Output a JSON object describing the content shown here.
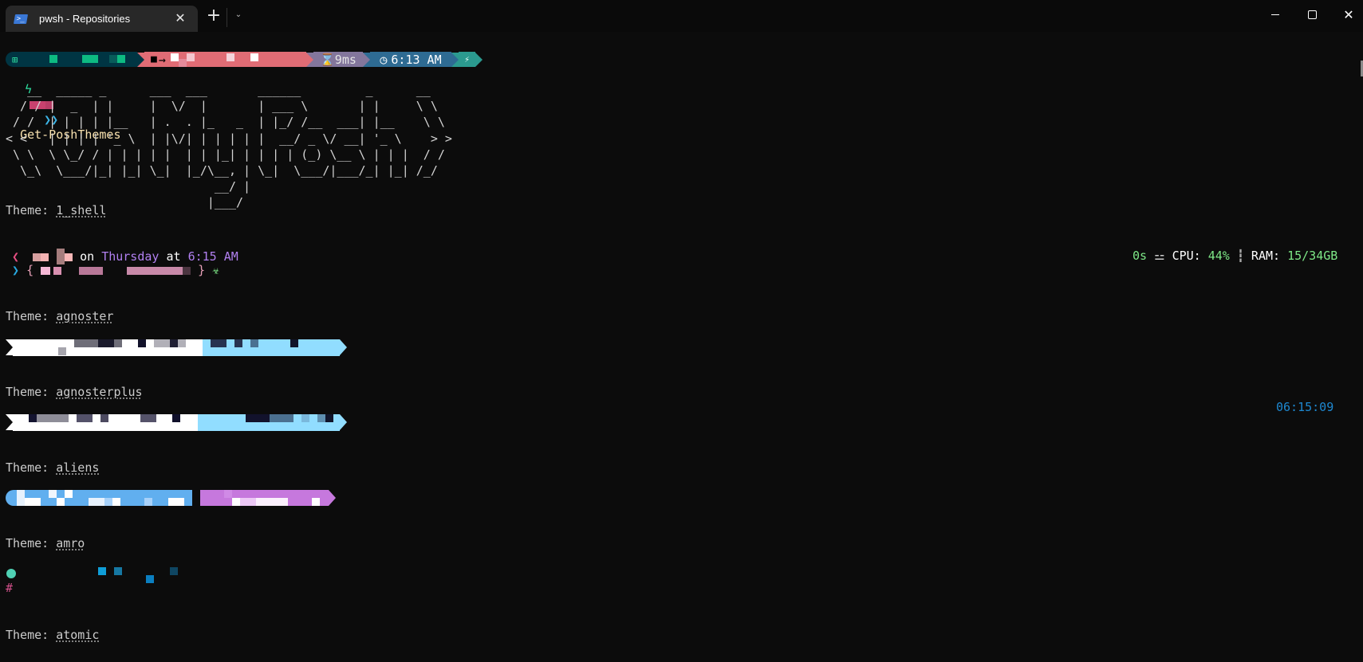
{
  "window": {
    "tab_title": "pwsh - Repositories",
    "tab_icon": "powershell-icon",
    "new_tab_label": "+",
    "dropdown_icon": "chevron-down-icon",
    "controls": [
      "minimize",
      "maximize",
      "close"
    ]
  },
  "prompt": {
    "segments": {
      "os_icon": "windows-icon",
      "path_icon": "folder-icon",
      "path_arrow": "→",
      "duration": "9ms",
      "duration_icon": "hourglass-icon",
      "time": "6:13 AM",
      "time_icon": "clock-icon",
      "status_icon": "lightning-icon"
    },
    "line2_icon": "lightning-icon",
    "chevron": "❯❯",
    "command": "Get-PoshThemes"
  },
  "banner": {
    "lines": [
      "   __  _____ _      ___  ___       ______         _      __   ",
      "  / / |  _  | |     |  \\/  |       | ___ \\       | |     \\ \\  ",
      " / /  | | | | |__   | .  . |_   _  | |_/ /__  ___| |__    \\ \\ ",
      "< <   | | | | '_ \\  | |\\/| | | | | |  __/ _ \\/ __| '_ \\    > >",
      " \\ \\  \\ \\_/ / | | | | |  | | |_| | | | | (_) \\__ \\ | | |  / / ",
      "  \\_\\  \\___/|_| |_| \\_|  |_/\\__, | \\_|  \\___/|___/_| |_| /_/  ",
      "                             __/ |                            ",
      "                            |___/                             "
    ]
  },
  "themes": [
    {
      "label": "Theme: ",
      "name": "1_shell",
      "preview": {
        "line1_left_icon": "chevron-left-icon",
        "on_text": "on",
        "day": "Thursday",
        "at_text": "at",
        "time": "6:15 AM",
        "line2_icon": "chevron-right-icon",
        "brace_open": "{",
        "brace_close": "}",
        "status_icon": "biohazard-icon",
        "right": {
          "duration": "0s",
          "cpu_label": "CPU:",
          "cpu_value": "44%",
          "separator": "┇",
          "ram_label": "RAM:",
          "ram_value": "15/34GB"
        }
      }
    },
    {
      "label": "Theme: ",
      "name": "agnoster"
    },
    {
      "label": "Theme: ",
      "name": "agnosterplus",
      "right_time": "06:15:09"
    },
    {
      "label": "Theme: ",
      "name": "aliens"
    },
    {
      "label": "Theme: ",
      "name": "amro",
      "preview": {
        "user_icon": "user-circle-icon",
        "prompt_char": "#"
      }
    },
    {
      "label": "Theme: ",
      "name": "atomic"
    }
  ],
  "colors": {
    "background": "#0c0c0c",
    "os_segment": "#003543",
    "path_segment": "#e06c75",
    "duration_segment": "#83769c",
    "time_segment": "#2e6b93",
    "status_segment": "#2b9a8f",
    "command": "#f9e2af",
    "chevron": "#3cb4e6",
    "shell_day": "#b180f0",
    "shell_green": "#7ee787",
    "agnoster_light": "#91ddff",
    "aliens_blue": "#61afef",
    "aliens_purple": "#c678dd",
    "right_time": "#1e88d0"
  }
}
